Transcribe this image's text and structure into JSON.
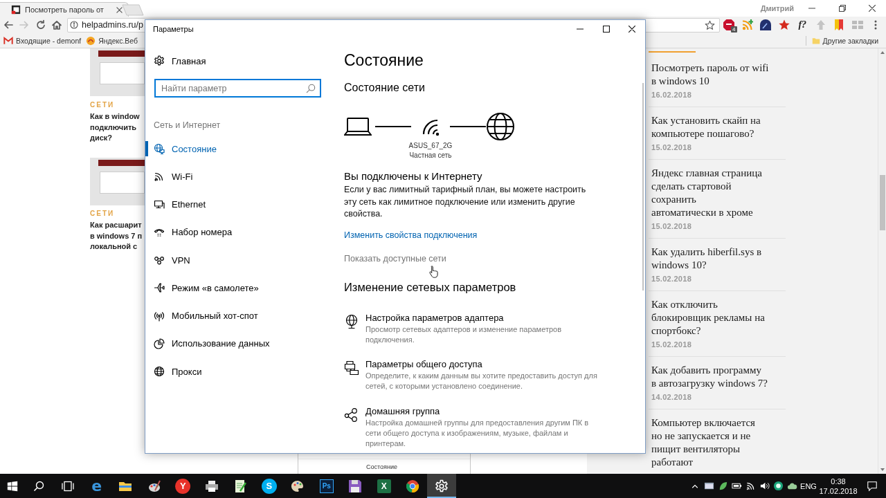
{
  "browser": {
    "tabs": [
      {
        "title": "Посмотреть пароль от",
        "selected": true
      }
    ],
    "profile_name": "Дмитрий",
    "forward_disabled": true,
    "address": "helpadmins.ru/p",
    "extensions": [
      {
        "kind": "octagon",
        "badge": "4"
      },
      {
        "kind": "feed"
      },
      {
        "kind": "dial"
      },
      {
        "kind": "star"
      },
      {
        "kind": "text",
        "label": "f?"
      },
      {
        "kind": "arrow"
      },
      {
        "kind": "flag"
      },
      {
        "kind": "grid"
      }
    ],
    "bookmarks": [
      {
        "kind": "mail",
        "label": "Входящие - demonf"
      },
      {
        "kind": "swirl",
        "label": "Яндекс.Веб"
      }
    ],
    "other_bookmarks": "Другие закладки"
  },
  "page": {
    "articles": [
      {
        "category": "СЕТИ",
        "title": "Как в window\nподключить\nдиск?"
      },
      {
        "category": "СЕТИ",
        "title": "Как расшарит\nв windows 7 п\nлокальной с"
      }
    ],
    "embedded_screenshot": {
      "title": "Состояние"
    },
    "popular": [
      {
        "title": "Посмотреть пароль от wifi\nв windows 10",
        "date": "16.02.2018"
      },
      {
        "title": "Как установить скайп на\nкомпьютере пошагово?",
        "date": "15.02.2018"
      },
      {
        "title": "Яндекс главная страница\nсделать стартовой\nсохранить\nавтоматически в хроме",
        "date": "15.02.2018"
      },
      {
        "title": "Как удалить hiberfil.sys в\nwindows 10?",
        "date": "15.02.2018"
      },
      {
        "title": "Как отключить\nблокировщик рекламы на\nспортбокс?",
        "date": "15.02.2018"
      },
      {
        "title": "Как добавить программу\nв автозагрузку windows 7?",
        "date": "14.02.2018"
      },
      {
        "title": "Компьютер включается\nно не запускается и не\nпищит вентиляторы\nработают"
      }
    ]
  },
  "settings_window": {
    "title": "Параметры",
    "home": "Главная",
    "search": {
      "placeholder": "Найти параметр"
    },
    "section": "Сеть и Интернет",
    "nav": [
      {
        "label": "Состояние",
        "selected": true
      },
      {
        "label": "Wi-Fi",
        "selected": false
      },
      {
        "label": "Ethernet",
        "selected": false
      },
      {
        "label": "Набор номера",
        "selected": false
      },
      {
        "label": "VPN",
        "selected": false
      },
      {
        "label": "Режим «в самолете»",
        "selected": false
      },
      {
        "label": "Мобильный хот-спот",
        "selected": false
      },
      {
        "label": "Использование данных",
        "selected": false
      },
      {
        "label": "Прокси",
        "selected": false
      }
    ],
    "page_title": "Состояние",
    "network_heading": "Состояние сети",
    "network": {
      "name": "ASUS_67_2G",
      "profile": "Частная сеть"
    },
    "connection_heading": "Вы подключены к Интернету",
    "connection_text": "Если у вас лимитный тарифный план, вы можете настроить эту сеть как лимитное подключение или изменить другие свойства.",
    "links": [
      {
        "label": "Изменить свойства подключения",
        "hovered": false
      },
      {
        "label": "Показать доступные сети",
        "hovered": true
      }
    ],
    "settings_heading": "Изменение сетевых параметров",
    "options": [
      {
        "title": "Настройка параметров адаптера",
        "description": "Просмотр сетевых адаптеров и изменение параметров подключения."
      },
      {
        "title": "Параметры общего доступа",
        "description": "Определите, к каким данным вы хотите предоставить доступ для сетей, с которыми установлено соединение."
      },
      {
        "title": "Домашняя группа",
        "description": "Настройка домашней группы для предоставления другим ПК в сети общего доступа к изображениям, музыке, файлам и принтерам."
      }
    ]
  },
  "taskbar": {
    "apps": [
      {
        "kind": "edge",
        "label": "e",
        "active": false
      },
      {
        "kind": "folder",
        "active": false
      },
      {
        "kind": "paint",
        "active": false
      },
      {
        "kind": "yandex",
        "label": "Y",
        "active": false
      },
      {
        "kind": "printer",
        "active": false
      },
      {
        "kind": "notepad",
        "active": false
      },
      {
        "kind": "skype",
        "label": "S",
        "active": false
      },
      {
        "kind": "palette",
        "active": false
      },
      {
        "kind": "photoshop",
        "label": "Ps",
        "active": false
      },
      {
        "kind": "floppy",
        "active": false
      },
      {
        "kind": "excel",
        "label": "X",
        "active": false
      },
      {
        "kind": "chrome",
        "active": false
      },
      {
        "kind": "settings",
        "active": true
      }
    ],
    "language": "ENG",
    "time": "0:38",
    "date": "17.02.2018"
  }
}
